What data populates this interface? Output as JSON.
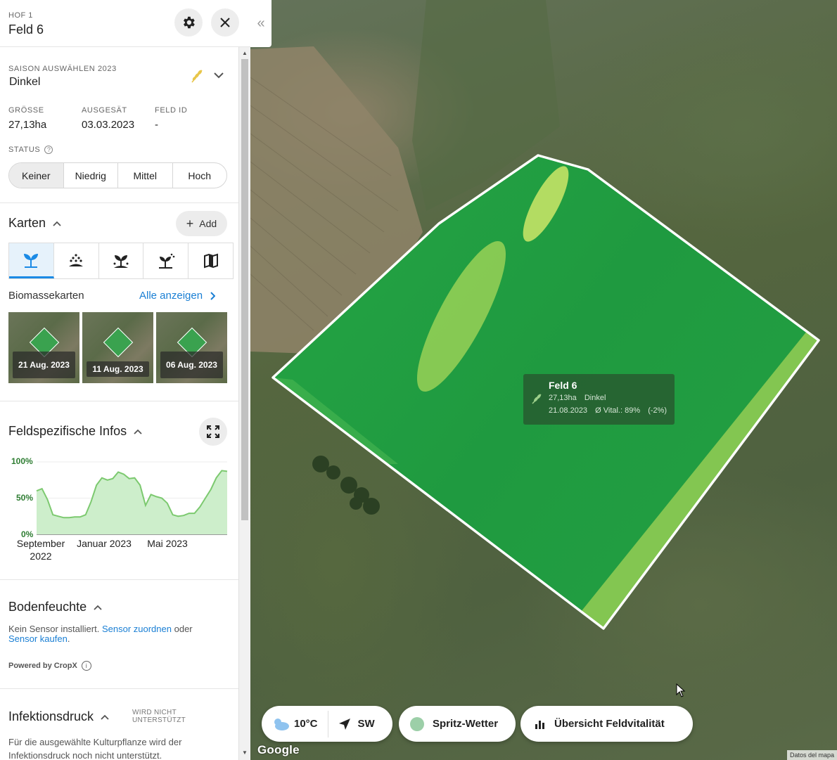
{
  "header": {
    "hof": "HOF 1",
    "title": "Feld 6"
  },
  "season": {
    "label": "SAISON AUSWÄHLEN 2023",
    "value": "Dinkel"
  },
  "stats": [
    {
      "label": "GRÖSSE",
      "value": "27,13ha"
    },
    {
      "label": "AUSGESÄT",
      "value": "03.03.2023"
    },
    {
      "label": "FELD ID",
      "value": "-"
    }
  ],
  "status": {
    "label": "STATUS",
    "options": [
      "Keiner",
      "Niedrig",
      "Mittel",
      "Hoch"
    ],
    "selected": "Keiner"
  },
  "karten": {
    "title": "Karten",
    "add_label": "Add",
    "tabs": [
      "sprout-icon",
      "seeding-icon",
      "plant-fertilize-icon",
      "plant-spray-icon",
      "map-icon"
    ],
    "active_tab": "sprout-icon",
    "biomasse_label": "Biomassekarten",
    "alle_label": "Alle anzeigen",
    "thumbnails": [
      {
        "date": "21 Aug. 2023"
      },
      {
        "date": "11 Aug. 2023"
      },
      {
        "date": "06 Aug. 2023"
      }
    ]
  },
  "feldinfos": {
    "title": "Feldspezifische Infos"
  },
  "chart_data": {
    "type": "area",
    "yticks": [
      "100%",
      "50%",
      "0%"
    ],
    "ylim": [
      0,
      100
    ],
    "xticks": [
      "September 2022",
      "Januar 2023",
      "Mai 2023"
    ],
    "values": [
      60,
      63,
      48,
      27,
      25,
      23,
      23,
      24,
      24,
      27,
      45,
      68,
      78,
      75,
      77,
      86,
      83,
      77,
      78,
      68,
      40,
      55,
      52,
      50,
      43,
      27,
      25,
      26,
      29,
      29,
      38,
      50,
      62,
      78,
      88,
      87
    ],
    "color": "#7cc96f",
    "fill": "#cdeecb"
  },
  "bodenfeuchte": {
    "title": "Bodenfeuchte",
    "text1": "Kein Sensor installiert.",
    "link1": "Sensor zuordnen",
    "text2": "oder",
    "link2": "Sensor kaufen",
    "text3": ".",
    "powered": "Powered by CropX"
  },
  "infektionsdruck": {
    "title": "Infektionsdruck",
    "badge_line1": "WIRD NICHT",
    "badge_line2": "UNTERSTÜTZT",
    "text_line1": "Für die ausgewählte Kulturpflanze wird der",
    "text_line2": "Infektionsdruck noch nicht unterstützt."
  },
  "map": {
    "tooltip": {
      "title": "Feld 6",
      "size": "27,13ha",
      "crop": "Dinkel",
      "date": "21.08.2023",
      "vital": "Ø Vital.: 89%",
      "change": "(-2%)"
    },
    "weather": {
      "temp": "10°C",
      "wind": "SW"
    },
    "spritz_label": "Spritz-Wetter",
    "uebersicht_label": "Übersicht Feldvitalität",
    "google": "Google",
    "attribution": "Datos del mapa"
  }
}
